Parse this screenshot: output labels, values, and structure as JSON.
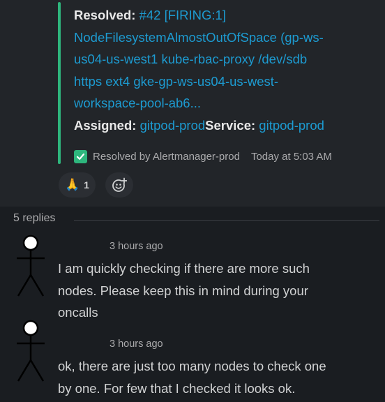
{
  "message": {
    "attachment": {
      "resolved_label": "Resolved:",
      "alert_link_parts": [
        " #42 [FIRING:1]",
        "NodeFilesystemAlmostOutOfSpace (gp-ws-",
        "us04-us-west1 kube-rbac-proxy /dev/sdb",
        "https ext4 gke-gp-ws-us04-us-west-",
        "workspace-pool-ab6..."
      ],
      "assigned_label": "Assigned:",
      "assigned_value": " gitpod-prod",
      "service_label": "Service:",
      "service_value": " gitpod-prod",
      "footer_text": "Resolved by Alertmanager-prod",
      "footer_time": "Today at 5:03 AM",
      "accent_color": "#2eb67d"
    },
    "reactions": [
      {
        "emoji": "🙏",
        "count": "1"
      }
    ],
    "add_reaction_icon": "add-emoji-icon"
  },
  "replies_count": "5 replies",
  "replies": [
    {
      "time": "3 hours ago",
      "lines": [
        "I am quickly checking if there are more such",
        "nodes. Please keep this in mind during your",
        "oncalls"
      ]
    },
    {
      "time": "3 hours ago",
      "lines": [
        "ok, there are just too many nodes to check one",
        "by one. For few that I checked it looks ok."
      ]
    }
  ]
}
